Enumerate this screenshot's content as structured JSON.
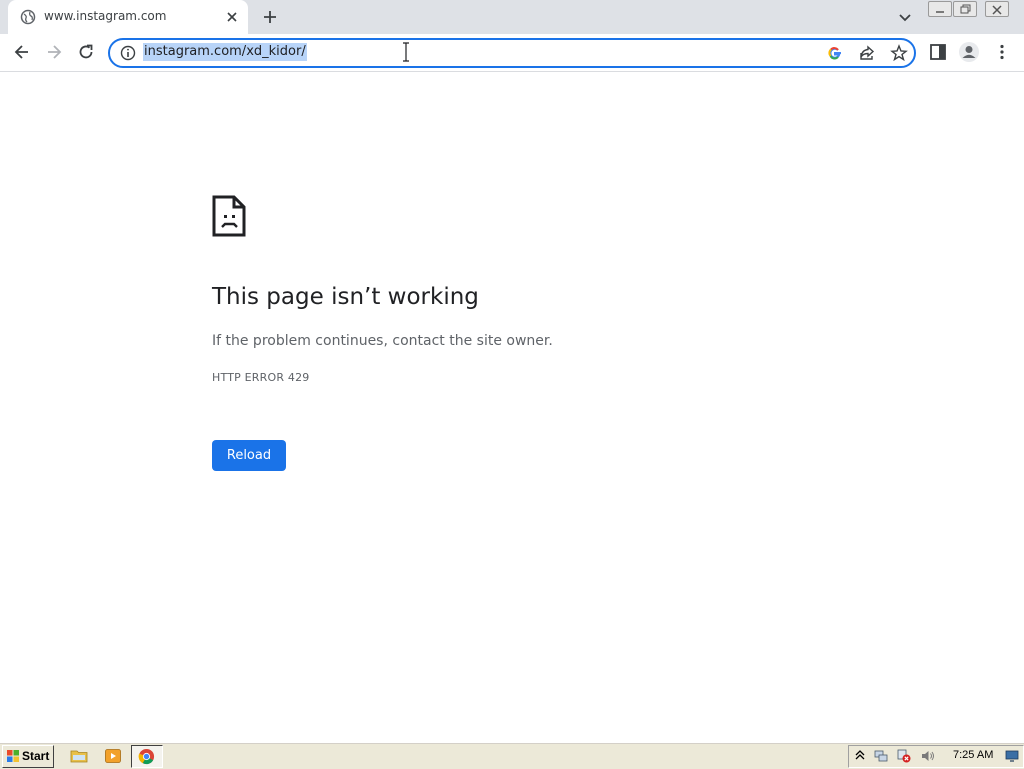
{
  "browser": {
    "tab": {
      "title": "www.instagram.com"
    },
    "omnibox": {
      "url": "instagram.com/xd_kidor/"
    }
  },
  "error_page": {
    "title": "This page isn’t working",
    "description": "If the problem continues, contact the site owner.",
    "error_code": "HTTP ERROR 429",
    "reload_label": "Reload"
  },
  "taskbar": {
    "start_label": "Start",
    "clock": "7:25 AM"
  },
  "colors": {
    "accent": "#1a73e8",
    "tabstrip_bg": "#dee1e6",
    "url_selection": "#b8d4f8",
    "taskbar_bg": "#ece9d8"
  },
  "icons": [
    "globe-icon",
    "close-icon",
    "plus-icon",
    "chevron-down-icon",
    "back-arrow-icon",
    "forward-arrow-icon",
    "reload-icon",
    "info-icon",
    "google-icon",
    "share-icon",
    "star-icon",
    "side-panel-icon",
    "profile-icon",
    "more-vert-icon",
    "sad-page-icon",
    "windows-flag-icon",
    "folder-icon",
    "media-player-icon",
    "chrome-icon",
    "tray-chevron-icon",
    "network-icon",
    "security-alert-icon",
    "volume-icon",
    "monitor-icon"
  ]
}
